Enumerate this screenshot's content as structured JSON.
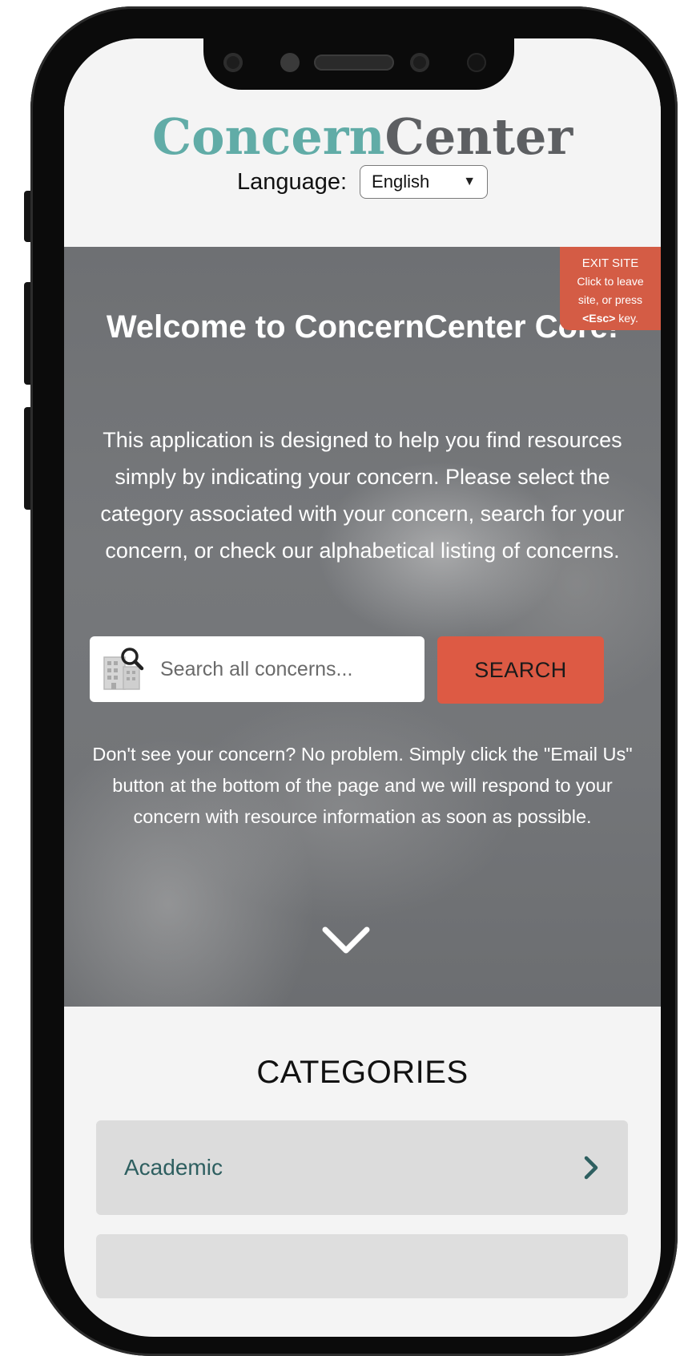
{
  "app": {
    "logo_part1": "Concern",
    "logo_part2": "Center"
  },
  "language": {
    "label": "Language:",
    "selected": "English"
  },
  "exit_site": {
    "title": "EXIT SITE",
    "line2": "Click to leave",
    "line3": "site, or press",
    "key": "<Esc>",
    "line4_suffix": " key."
  },
  "hero": {
    "title": "Welcome to ConcernCenter Core!",
    "intro": "This application is designed to help you find resources simply by indicating your concern. Please select the category associated with your concern, search for your concern, or check our alphabetical listing of concerns.",
    "note": "Don't see your concern? No problem. Simply click the \"Email Us\" button at the bottom of the page and we will respond to your concern with resource information as soon as possible."
  },
  "search": {
    "placeholder": "Search all concerns...",
    "value": "",
    "button_label": "SEARCH"
  },
  "categories": {
    "heading": "CATEGORIES",
    "items": [
      {
        "label": "Academic"
      },
      {
        "label": ""
      }
    ]
  },
  "colors": {
    "brand_teal": "#61aca7",
    "brand_gray": "#5d5f62",
    "accent_red": "#dd5a44",
    "category_text": "#2e5f60"
  },
  "icons": {
    "search": "building-search-icon",
    "scroll": "chevron-down-icon",
    "category": "chevron-right-icon",
    "select": "caret-down-icon"
  }
}
